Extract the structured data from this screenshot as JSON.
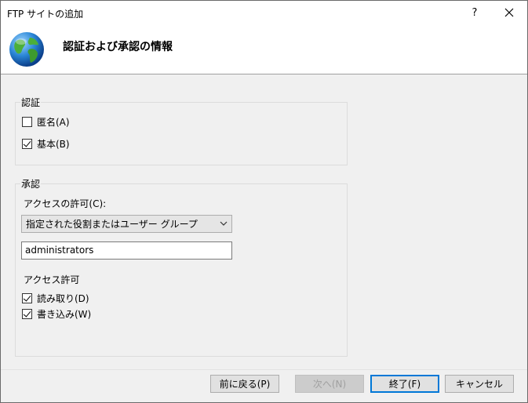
{
  "window": {
    "title": "FTP サイトの追加",
    "help_label": "?"
  },
  "header": {
    "title": "認証および承認の情報"
  },
  "auth": {
    "group_label": "認証",
    "anonymous": {
      "label": "匿名(A)",
      "checked": false
    },
    "basic": {
      "label": "基本(B)",
      "checked": true
    }
  },
  "authorization": {
    "group_label": "承認",
    "allow_access_label": "アクセスの許可(C):",
    "allow_access_value": "指定された役割またはユーザー グループ",
    "roles_value": "administrators",
    "permissions_label": "アクセス許可",
    "read": {
      "label": "読み取り(D)",
      "checked": true
    },
    "write": {
      "label": "書き込み(W)",
      "checked": true
    }
  },
  "buttons": {
    "previous": "前に戻る(P)",
    "next": "次へ(N)",
    "finish": "終了(F)",
    "cancel": "キャンセル"
  },
  "colors": {
    "accent": "#0078d7"
  },
  "icons": {
    "header": "globe-icon",
    "close": "close-icon",
    "dropdown": "chevron-down-icon"
  }
}
